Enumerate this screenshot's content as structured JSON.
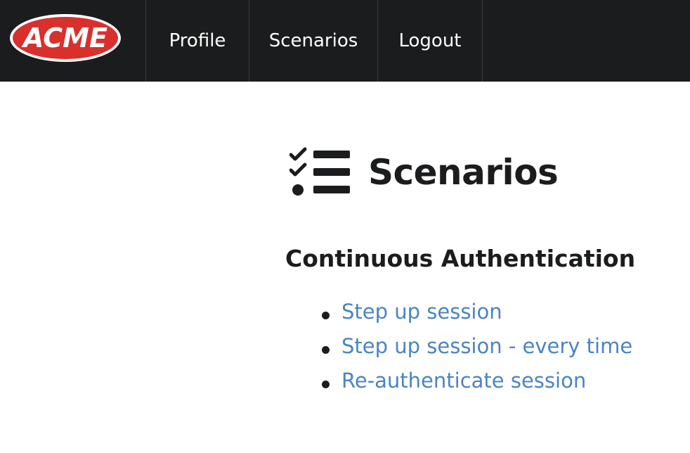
{
  "nav": {
    "logo_text": "ACME",
    "items": [
      {
        "label": "Profile"
      },
      {
        "label": "Scenarios"
      },
      {
        "label": "Logout"
      }
    ]
  },
  "page": {
    "title": "Scenarios",
    "title_icon": "tasks-list-icon",
    "section": {
      "title": "Continuous Authentication",
      "links": [
        {
          "label": "Step up session"
        },
        {
          "label": "Step up session - every time"
        },
        {
          "label": "Re-authenticate session"
        }
      ]
    }
  },
  "colors": {
    "navbar_bg": "#1b1c1d",
    "logo_red": "#d9302c",
    "link_blue": "#4a84c4",
    "text_dark": "#1b1c1d"
  }
}
